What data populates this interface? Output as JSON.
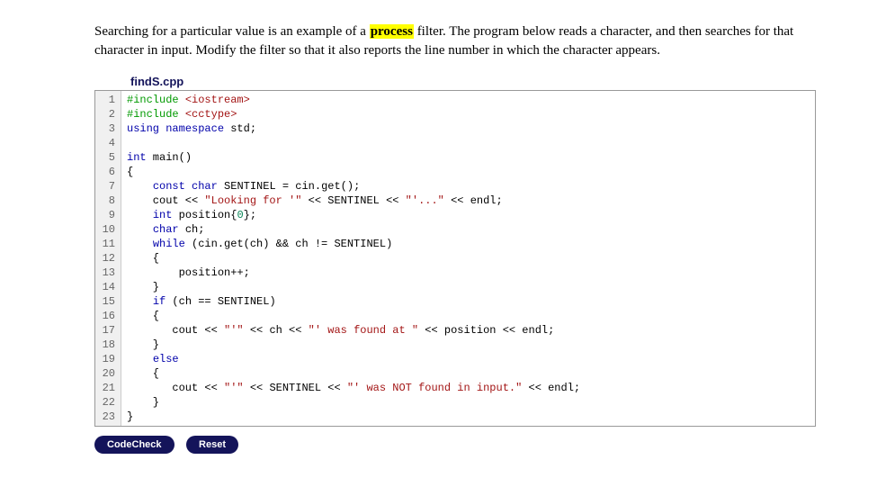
{
  "prose": {
    "part1": "Searching for a particular value is an example of a ",
    "highlight": "process",
    "part2": " filter. The program below reads a character, and then searches for that character in input. Modify the filter so that it also reports the line number in which the character appears."
  },
  "filename": "findS.cpp",
  "code": {
    "lines": [
      {
        "n": "1",
        "html": "<span class='tok-pre'>#include</span> <span class='tok-str'>&lt;iostream&gt;</span>"
      },
      {
        "n": "2",
        "html": "<span class='tok-pre'>#include</span> <span class='tok-str'>&lt;cctype&gt;</span>"
      },
      {
        "n": "3",
        "html": "<span class='tok-kw'>using</span> <span class='tok-kw'>namespace</span> std;"
      },
      {
        "n": "4",
        "html": ""
      },
      {
        "n": "5",
        "html": "<span class='tok-type'>int</span> main()"
      },
      {
        "n": "6",
        "html": "{"
      },
      {
        "n": "7",
        "html": "    <span class='tok-kw'>const</span> <span class='tok-type'>char</span> SENTINEL = cin.get();"
      },
      {
        "n": "8",
        "html": "    cout &lt;&lt; <span class='tok-str'>\"Looking for '\"</span> &lt;&lt; SENTINEL &lt;&lt; <span class='tok-str'>\"'...\"</span> &lt;&lt; endl;"
      },
      {
        "n": "9",
        "html": "    <span class='tok-type'>int</span> position{<span class='tok-num'>0</span>};"
      },
      {
        "n": "10",
        "html": "    <span class='tok-type'>char</span> ch;"
      },
      {
        "n": "11",
        "html": "    <span class='tok-kw'>while</span> (cin.get(ch) &amp;&amp; ch != SENTINEL)"
      },
      {
        "n": "12",
        "html": "    {"
      },
      {
        "n": "13",
        "html": "        position++;"
      },
      {
        "n": "14",
        "html": "    }"
      },
      {
        "n": "15",
        "html": "    <span class='tok-kw'>if</span> (ch == SENTINEL)"
      },
      {
        "n": "16",
        "html": "    {"
      },
      {
        "n": "17",
        "html": "       cout &lt;&lt; <span class='tok-str'>\"'\"</span> &lt;&lt; ch &lt;&lt; <span class='tok-str'>\"' was found at \"</span> &lt;&lt; position &lt;&lt; endl;"
      },
      {
        "n": "18",
        "html": "    }"
      },
      {
        "n": "19",
        "html": "    <span class='tok-kw'>else</span>"
      },
      {
        "n": "20",
        "html": "    {"
      },
      {
        "n": "21",
        "html": "       cout &lt;&lt; <span class='tok-str'>\"'\"</span> &lt;&lt; SENTINEL &lt;&lt; <span class='tok-str'>\"' was NOT found in input.\"</span> &lt;&lt; endl;"
      },
      {
        "n": "22",
        "html": "    }"
      },
      {
        "n": "23",
        "html": "}"
      }
    ]
  },
  "buttons": {
    "codecheck": "CodeCheck",
    "reset": "Reset"
  }
}
